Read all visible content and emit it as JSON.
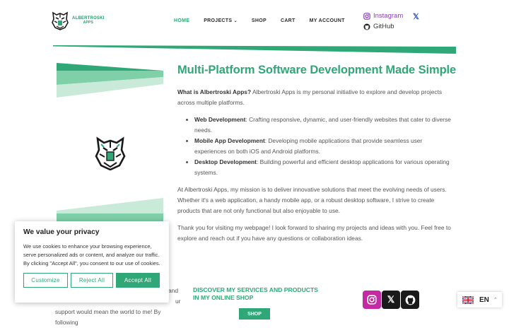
{
  "header": {
    "brand": {
      "line1": "Albertroski",
      "line2": "Apps"
    },
    "nav": [
      {
        "label": "HOME",
        "active": true
      },
      {
        "label": "PROJECTS",
        "active": false,
        "dropdown": true
      },
      {
        "label": "SHOP",
        "active": false
      },
      {
        "label": "CART",
        "active": false
      },
      {
        "label": "MY ACCOUNT",
        "active": false
      }
    ],
    "social": {
      "instagram": "Instagram",
      "github": "GitHub",
      "x": "𝕏"
    }
  },
  "main": {
    "headline": "Multi-Platform Software Development Made Simple",
    "intro_bold": "What is Albertroski Apps?",
    "intro_text": " Albertroski Apps is my personal initiative to explore and develop projects across multiple platforms.",
    "features": [
      {
        "title": "Web Development",
        "text": ": Crafting responsive, dynamic, and user-friendly websites that cater to diverse needs."
      },
      {
        "title": "Mobile App Development",
        "text": ": Developing mobile applications that provide seamless user experiences on both iOS and Android platforms."
      },
      {
        "title": "Desktop Development",
        "text": ": Building powerful and efficient desktop applications for various operating systems."
      }
    ],
    "mission": "At Albertroski Apps, my mission is to deliver innovative solutions that meet the evolving needs of users. Whether it's a web application, a handy mobile app, or a robust desktop software, I strive to create products that are not only functional but also enjoyable to use.",
    "thanks": "Thank you for visiting my webpage! I look forward to sharing my projects and ideas with you. Feel free to explore and reach out if you have any questions or collaboration ideas."
  },
  "footer": {
    "left_line1": "and",
    "left_line2": "ur",
    "left_line3": "support would mean the world to me! By following",
    "discover": "DISCOVER MY SERVICES AND PRODUCTS IN MY ONLINE SHOP",
    "shop_button": "SHOP"
  },
  "language": {
    "code": "EN"
  },
  "cookie": {
    "title": "We value your privacy",
    "text": "We use cookies to enhance your browsing experience, serve personalized ads or content, and analyze our traffic. By clicking \"Accept All\", you consent to our use of cookies.",
    "customize": "Customize",
    "reject": "Reject All",
    "accept": "Accept All"
  },
  "colors": {
    "accent": "#2fa776",
    "dark": "#1a1a1a",
    "instagram": "#c32aa3"
  }
}
